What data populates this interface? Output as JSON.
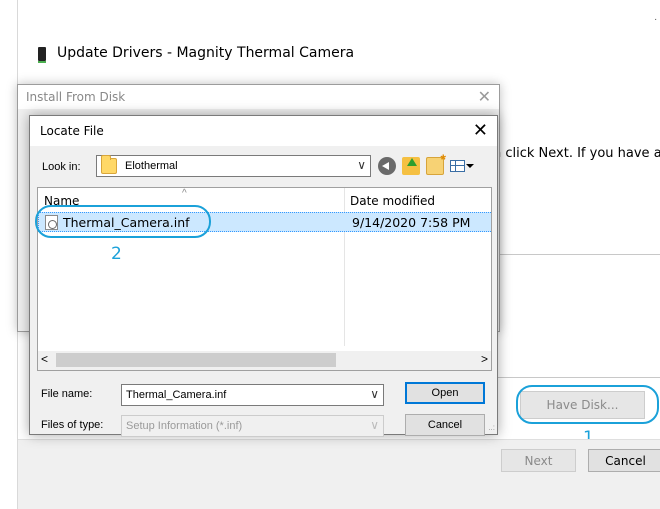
{
  "wizard": {
    "title": "Update Drivers - Magnity Thermal Camera",
    "partial_text": "n click Next. If you have a",
    "link_fragment": "e",
    "close_glyph": "·",
    "have_disk_label": "Have Disk...",
    "next_label": "Next",
    "cancel_label": "Cancel"
  },
  "install_dialog": {
    "title": "Install From Disk",
    "close_glyph": "✕"
  },
  "locate_dialog": {
    "title": "Locate File",
    "close_glyph": "✕",
    "look_in_label": "Look in:",
    "look_in_value": "Elothermal",
    "columns": {
      "name": "Name",
      "date_modified": "Date modified"
    },
    "files": [
      {
        "name": "Thermal_Camera.inf",
        "date_modified": "9/14/2020 7:58 PM",
        "selected": true
      }
    ],
    "file_name_label": "File name:",
    "file_name_value": "Thermal_Camera.inf",
    "files_of_type_label": "Files of type:",
    "files_of_type_value": "Setup Information (*.inf)",
    "open_label": "Open",
    "cancel_label": "Cancel"
  },
  "annotations": {
    "callout_1": "1",
    "callout_2": "2",
    "color": "#1ba1d9"
  },
  "icons": {
    "chevron_down": "∨",
    "sort_caret": "^",
    "scroll_left": "<",
    "scroll_right": ">",
    "size_grip": "..:"
  }
}
